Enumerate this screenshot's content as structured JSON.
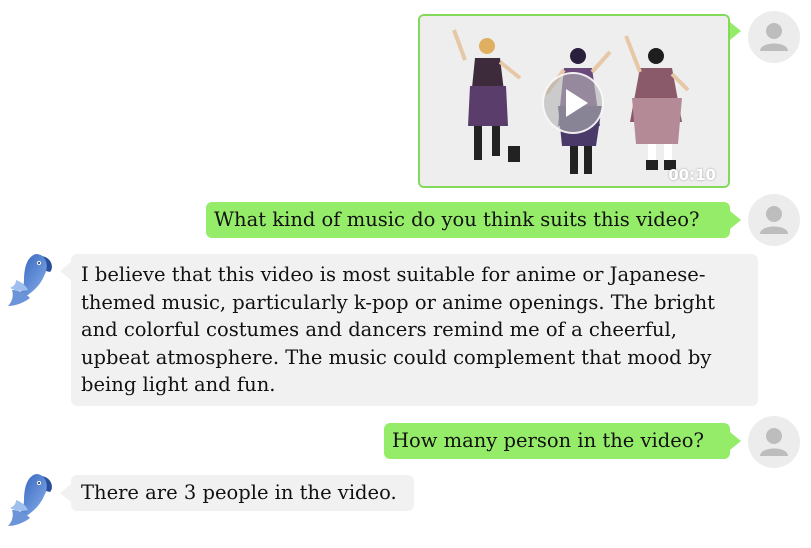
{
  "conversation": {
    "video_message": {
      "duration": "00:10",
      "play_icon": "play-icon"
    },
    "messages": [
      {
        "role": "user",
        "text": "What kind of music do you think suits this video?"
      },
      {
        "role": "assistant",
        "text": "I believe that this video is most suitable for anime or Japanese-themed music, particularly k-pop or anime openings. The bright and colorful costumes and dancers remind me of a cheerful, upbeat atmosphere. The music could complement that mood by being light and fun."
      },
      {
        "role": "user",
        "text": "How many person in the video?"
      },
      {
        "role": "assistant",
        "text": "There are 3 people in the video."
      }
    ]
  },
  "colors": {
    "user_bubble": "#95ec69",
    "assistant_bubble": "#f1f1f1",
    "avatar_bg": "#ececec",
    "bot_avatar": "#4a7fd4"
  },
  "icons": {
    "user_avatar": "person-icon",
    "assistant_avatar": "parrot-icon"
  }
}
